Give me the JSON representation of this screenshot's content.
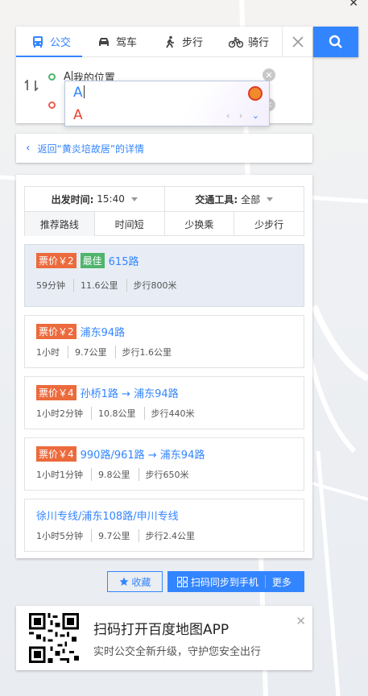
{
  "modes": [
    {
      "label": "公交",
      "icon": "bus-icon",
      "active": true
    },
    {
      "label": "驾车",
      "icon": "car-icon",
      "active": false
    },
    {
      "label": "步行",
      "icon": "walk-icon",
      "active": false
    },
    {
      "label": "骑行",
      "icon": "bike-icon",
      "active": false
    }
  ],
  "search": {
    "start_prefix": "A",
    "start_value": "我的位置",
    "end_value": ""
  },
  "ime": {
    "candidate1": "A",
    "candidate2": "A"
  },
  "back_link": "返回“黄炎培故居”的详情",
  "filters": {
    "depart_label": "出发时间:",
    "depart_value": "15:40",
    "vehicle_label": "交通工具:",
    "vehicle_value": "全部",
    "tabs": [
      "推荐路线",
      "时间短",
      "少换乘",
      "少步行"
    ]
  },
  "routes": [
    {
      "price": "票价￥2",
      "badge": "最佳",
      "name": "615路",
      "time": "59分钟",
      "distance": "11.6公里",
      "walk": "步行800米"
    },
    {
      "price": "票价￥2",
      "badge": "",
      "name": "浦东94路",
      "time": "1小时",
      "distance": "9.7公里",
      "walk": "步行1.6公里"
    },
    {
      "price": "票价￥4",
      "badge": "",
      "name": "孙桥1路 → 浦东94路",
      "time": "1小时2分钟",
      "distance": "10.8公里",
      "walk": "步行440米"
    },
    {
      "price": "票价￥4",
      "badge": "",
      "name": "990路/961路 → 浦东94路",
      "time": "1小时1分钟",
      "distance": "9.8公里",
      "walk": "步行650米"
    },
    {
      "price": "",
      "badge": "",
      "name": "徐川专线/浦东108路/申川专线",
      "time": "1小时5分钟",
      "distance": "9.7公里",
      "walk": "步行2.4公里"
    }
  ],
  "actions": {
    "favorite": "收藏",
    "sync": "扫码同步到手机",
    "more": "更多"
  },
  "promo": {
    "title": "扫码打开百度地图APP",
    "subtitle": "实时公交全新升级，守护您安全出行"
  },
  "colors": {
    "accent": "#3385ff",
    "price_tag": "#ec6a3c",
    "best_tag": "#4fb46c"
  }
}
